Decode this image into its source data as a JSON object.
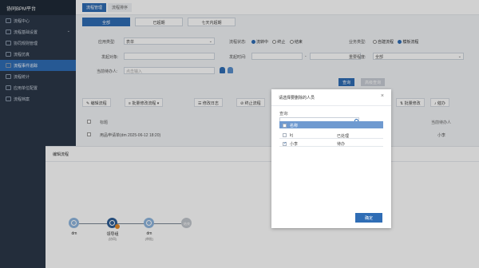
{
  "sidebar": {
    "brand": "协同BPM平台",
    "items": [
      {
        "label": "流程中心"
      },
      {
        "label": "流程基础设置"
      },
      {
        "label": "协同规则管理"
      },
      {
        "label": "流程仿真"
      },
      {
        "label": "流程事件追踪"
      },
      {
        "label": "流程统计"
      },
      {
        "label": "应用单位配置"
      },
      {
        "label": "流程档案"
      }
    ]
  },
  "top_tabs": [
    "流程管理",
    "流程排序"
  ],
  "segments": [
    "全部",
    "已超期",
    "七天内超期"
  ],
  "form": {
    "app_type_label": "应用类型:",
    "app_type_value": "表单",
    "flow_state_label": "流程状态:",
    "flow_state_opts": [
      "流转中",
      "终止",
      "结束"
    ],
    "flow_type_label": "业务类型:",
    "flow_type_opts": [
      "自建流程",
      "模板流程"
    ],
    "initiator_label": "发起对象:",
    "start_time_label": "发起时间:",
    "important_label": "重要程度:",
    "important_value": "全部",
    "handler_label": "当前待办人:",
    "handler_placeholder": "点击输入",
    "search_btn": "查询",
    "reset_btn": "高级查询"
  },
  "toolbar": [
    "编辑流程",
    "批量修改流程",
    "修改日志",
    "终止流程",
    "批量修改",
    "催办"
  ],
  "table": {
    "header": "标题",
    "right_header": "当前待办人",
    "row_title": "用品申请单(dm 2025-06-12 18:20)",
    "row_right": "小李"
  },
  "panel": {
    "title": "编辑流程",
    "nodes": [
      {
        "label": "dm",
        "sub": ""
      },
      {
        "label": "领导组",
        "sub": "(协同)"
      },
      {
        "label": "dm",
        "sub": "(审批)"
      },
      {
        "label": "结束",
        "sub": ""
      }
    ]
  },
  "dialog": {
    "title": "请选择要删除的人员",
    "search_label": "查询:",
    "col_name": "名称",
    "rows": [
      {
        "name": "lrj",
        "state": "已处理",
        "checked": false
      },
      {
        "name": "小李",
        "state": "待办",
        "checked": true
      }
    ],
    "ok": "确定"
  },
  "colors": {
    "primary": "#2f6db5",
    "sidebar": "#2b3849"
  }
}
